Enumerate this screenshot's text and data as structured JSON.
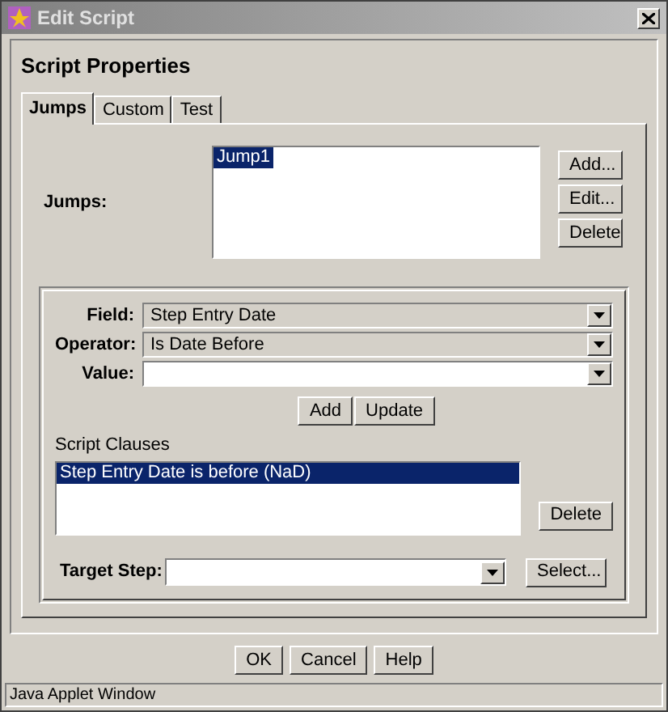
{
  "window": {
    "title": "Edit Script"
  },
  "heading": "Script Properties",
  "tabs": [
    {
      "label": "Jumps",
      "selected": true
    },
    {
      "label": "Custom",
      "selected": false
    },
    {
      "label": "Test",
      "selected": false
    }
  ],
  "jumps": {
    "label": "Jumps:",
    "items": [
      {
        "label": "Jump1",
        "selected": true
      }
    ],
    "buttons": [
      "Add...",
      "Edit...",
      "Delete"
    ]
  },
  "fields": [
    {
      "label": "Field:",
      "value": "Step Entry Date",
      "kind": "combo"
    },
    {
      "label": "Operator:",
      "value": "Is Date Before",
      "kind": "combo"
    },
    {
      "label": "Value:",
      "kind": "editable"
    }
  ],
  "clause_buttons": [
    "Add",
    "Update"
  ],
  "clauses": {
    "label": "Script Clauses",
    "items": [
      {
        "label": "Step Entry Date is before (NaD)",
        "selected": true
      }
    ],
    "button": "Delete"
  },
  "target": {
    "label": "Target Step:",
    "button": "Select..."
  },
  "buttons": [
    "OK",
    "Cancel",
    "Help"
  ],
  "status_bar": "Java Applet Window"
}
